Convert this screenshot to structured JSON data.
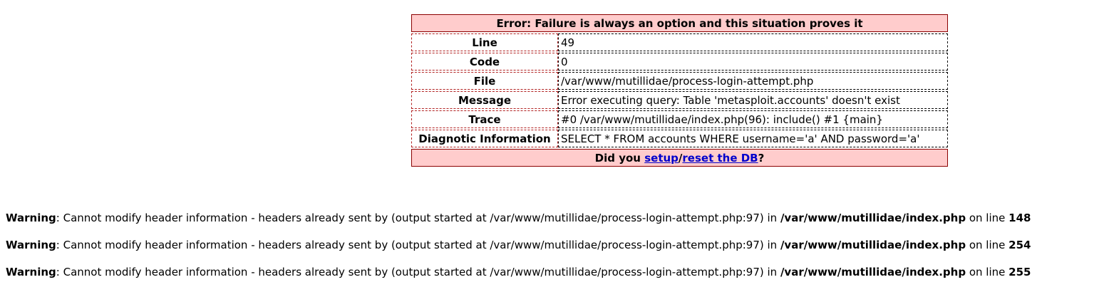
{
  "error_box": {
    "title": "Error: Failure is always an option and this situation proves it",
    "rows": [
      {
        "label": "Line",
        "value": "49"
      },
      {
        "label": "Code",
        "value": "0"
      },
      {
        "label": "File",
        "value": "/var/www/mutillidae/process-login-attempt.php"
      },
      {
        "label": "Message",
        "value": "Error executing query: Table 'metasploit.accounts' doesn't exist"
      },
      {
        "label": "Trace",
        "value": "#0 /var/www/mutillidae/index.php(96): include() #1 {main}"
      },
      {
        "label": "Diagnotic Information",
        "value": "SELECT * FROM accounts WHERE username='a' AND password='a'"
      }
    ],
    "footer": {
      "prefix": "Did you ",
      "link1": "setup",
      "separator": "/",
      "link2": "reset the DB",
      "suffix": "?"
    }
  },
  "warnings": [
    {
      "label": "Warning",
      "text": ": Cannot modify header information - headers already sent by (output started at /var/www/mutillidae/process-login-attempt.php:97) in ",
      "file": "/var/www/mutillidae/index.php",
      "on_line": " on line ",
      "line": "148"
    },
    {
      "label": "Warning",
      "text": ": Cannot modify header information - headers already sent by (output started at /var/www/mutillidae/process-login-attempt.php:97) in ",
      "file": "/var/www/mutillidae/index.php",
      "on_line": " on line ",
      "line": "254"
    },
    {
      "label": "Warning",
      "text": ": Cannot modify header information - headers already sent by (output started at /var/www/mutillidae/process-login-attempt.php:97) in ",
      "file": "/var/www/mutillidae/index.php",
      "on_line": " on line ",
      "line": "255"
    }
  ]
}
